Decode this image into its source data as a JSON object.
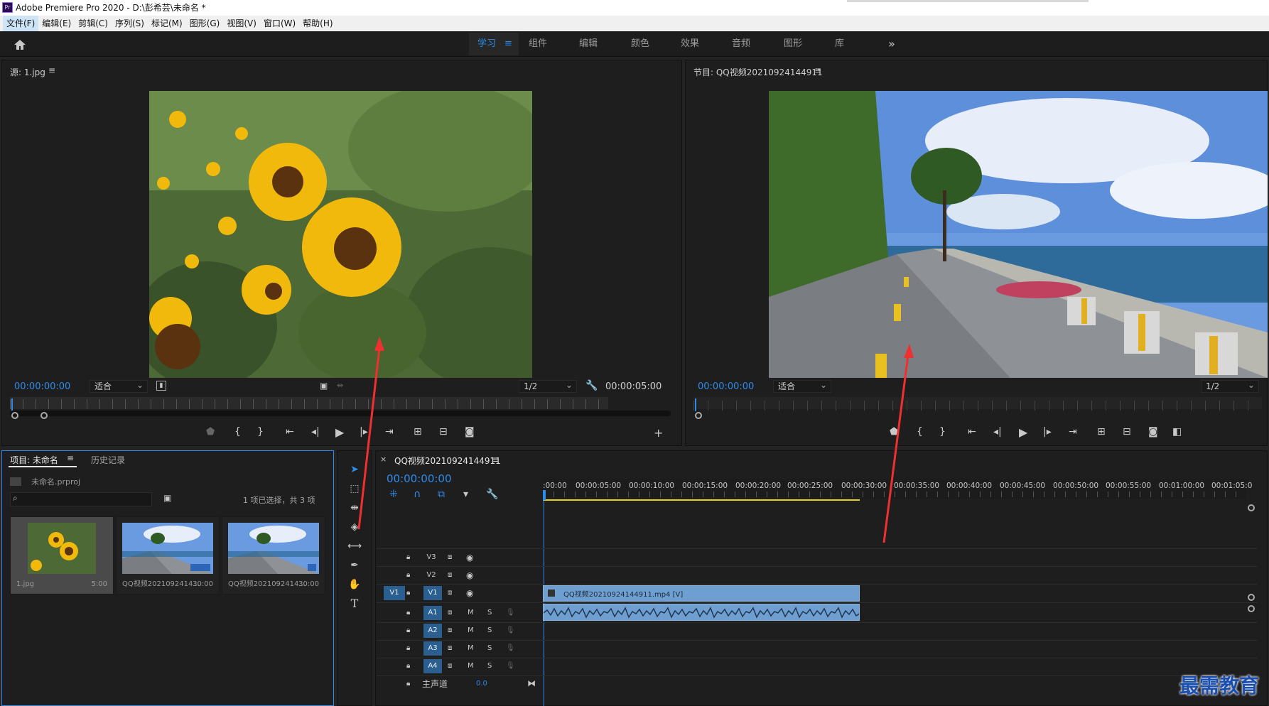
{
  "app": {
    "title": "Adobe Premiere Pro 2020 - D:\\彭希芸\\未命名 *",
    "icon_label": "Pr"
  },
  "menu": [
    "文件(F)",
    "编辑(E)",
    "剪辑(C)",
    "序列(S)",
    "标记(M)",
    "图形(G)",
    "视图(V)",
    "窗口(W)",
    "帮助(H)"
  ],
  "workspace_tabs": [
    {
      "label": "学习",
      "active": true
    },
    {
      "label": "组件",
      "active": false
    },
    {
      "label": "编辑",
      "active": false
    },
    {
      "label": "颜色",
      "active": false
    },
    {
      "label": "效果",
      "active": false
    },
    {
      "label": "音频",
      "active": false
    },
    {
      "label": "图形",
      "active": false
    },
    {
      "label": "库",
      "active": false
    }
  ],
  "workspace_more": "»",
  "source_monitor": {
    "title": "源: 1.jpg",
    "timecode": "00:00:00:00",
    "fit": "适合",
    "resolution": "1/2",
    "duration": "00:00:05:00"
  },
  "program_monitor": {
    "title": "节目: QQ视频20210924144911",
    "timecode": "00:00:00:00",
    "fit": "适合",
    "resolution": "1/2"
  },
  "project_panel": {
    "tab_project": "项目: 未命名",
    "tab_history": "历史记录",
    "project_file": "未命名.prproj",
    "selection_info": "1 项已选择，共 3 项",
    "items": [
      {
        "name": "1.jpg",
        "duration": "5:00"
      },
      {
        "name": "QQ视频2021092414...",
        "duration": "30:00"
      },
      {
        "name": "QQ视频2021092414...",
        "duration": "30:00"
      }
    ]
  },
  "timeline": {
    "sequence_name": "QQ视频20210924144911",
    "timecode": "00:00:00:00",
    "ruler": [
      ":00:00",
      "00:00:05:00",
      "00:00:10:00",
      "00:00:15:00",
      "00:00:20:00",
      "00:00:25:00",
      "00:00:30:00",
      "00:00:35:00",
      "00:00:40:00",
      "00:00:45:00",
      "00:00:50:00",
      "00:00:55:00",
      "00:01:00:00",
      "00:01:05:0"
    ],
    "video_tracks": [
      "V3",
      "V2",
      "V1"
    ],
    "audio_tracks": [
      "A1",
      "A2",
      "A3",
      "A4"
    ],
    "source_patch": "V1",
    "mute_label": "M",
    "solo_label": "S",
    "master_label": "主声道",
    "master_value": "0.0",
    "video_clip": "QQ视频20210924144911.mp4 [V]"
  },
  "watermark": "最需教育",
  "colors": {
    "accent": "#2d8ceb",
    "clip_video": "#6e9fd0",
    "clip_audio": "#6e9fd0",
    "arrow": "#f03030"
  }
}
